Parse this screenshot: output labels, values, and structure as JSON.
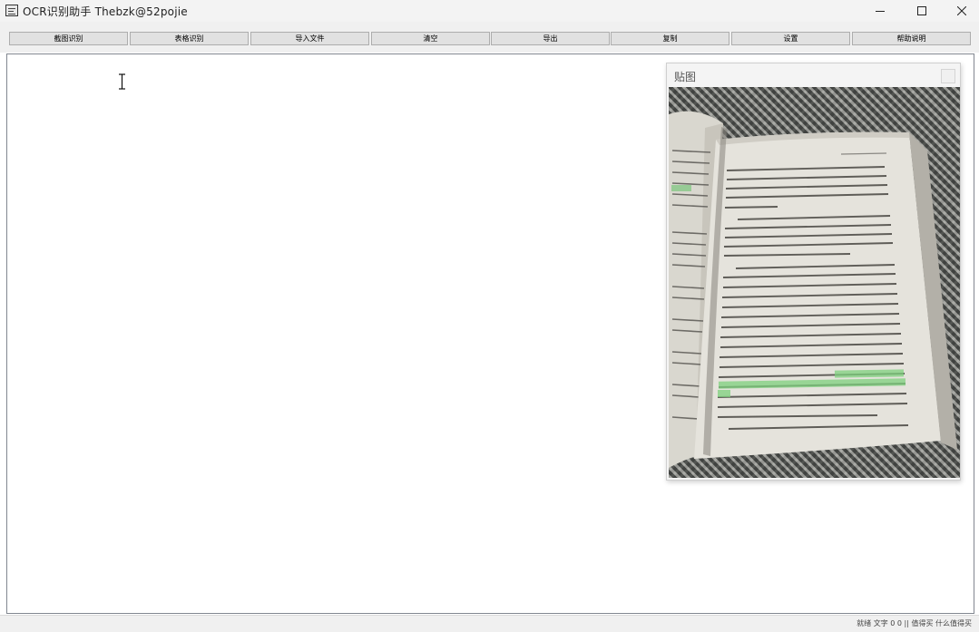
{
  "window": {
    "title": "OCR识别助手   Thebzk@52pojie",
    "icon": "scanner-app-icon",
    "controls": [
      "minimize-icon",
      "maximize-icon",
      "close-icon"
    ]
  },
  "toolbar": {
    "buttons": [
      "截图识别",
      "表格识别",
      "导入文件",
      "清空",
      "导出",
      "复制",
      "设置",
      "帮助说明"
    ]
  },
  "editor": {
    "text": "",
    "cursor": "text-ibeam-cursor"
  },
  "panel": {
    "title": "贴图",
    "image": "photo-of-open-book-with-highlighted-text"
  },
  "status": {
    "text": "就绪  文字 0 0  ||  值得买  什么值得买"
  },
  "colors": {
    "titlebar_bg": "#f3f3f3",
    "toolbar_bg": "#f0f0f0",
    "button_bg": "#e1e1e1",
    "editor_bg": "#ffffff",
    "highlight_green": "#7ed07e"
  }
}
